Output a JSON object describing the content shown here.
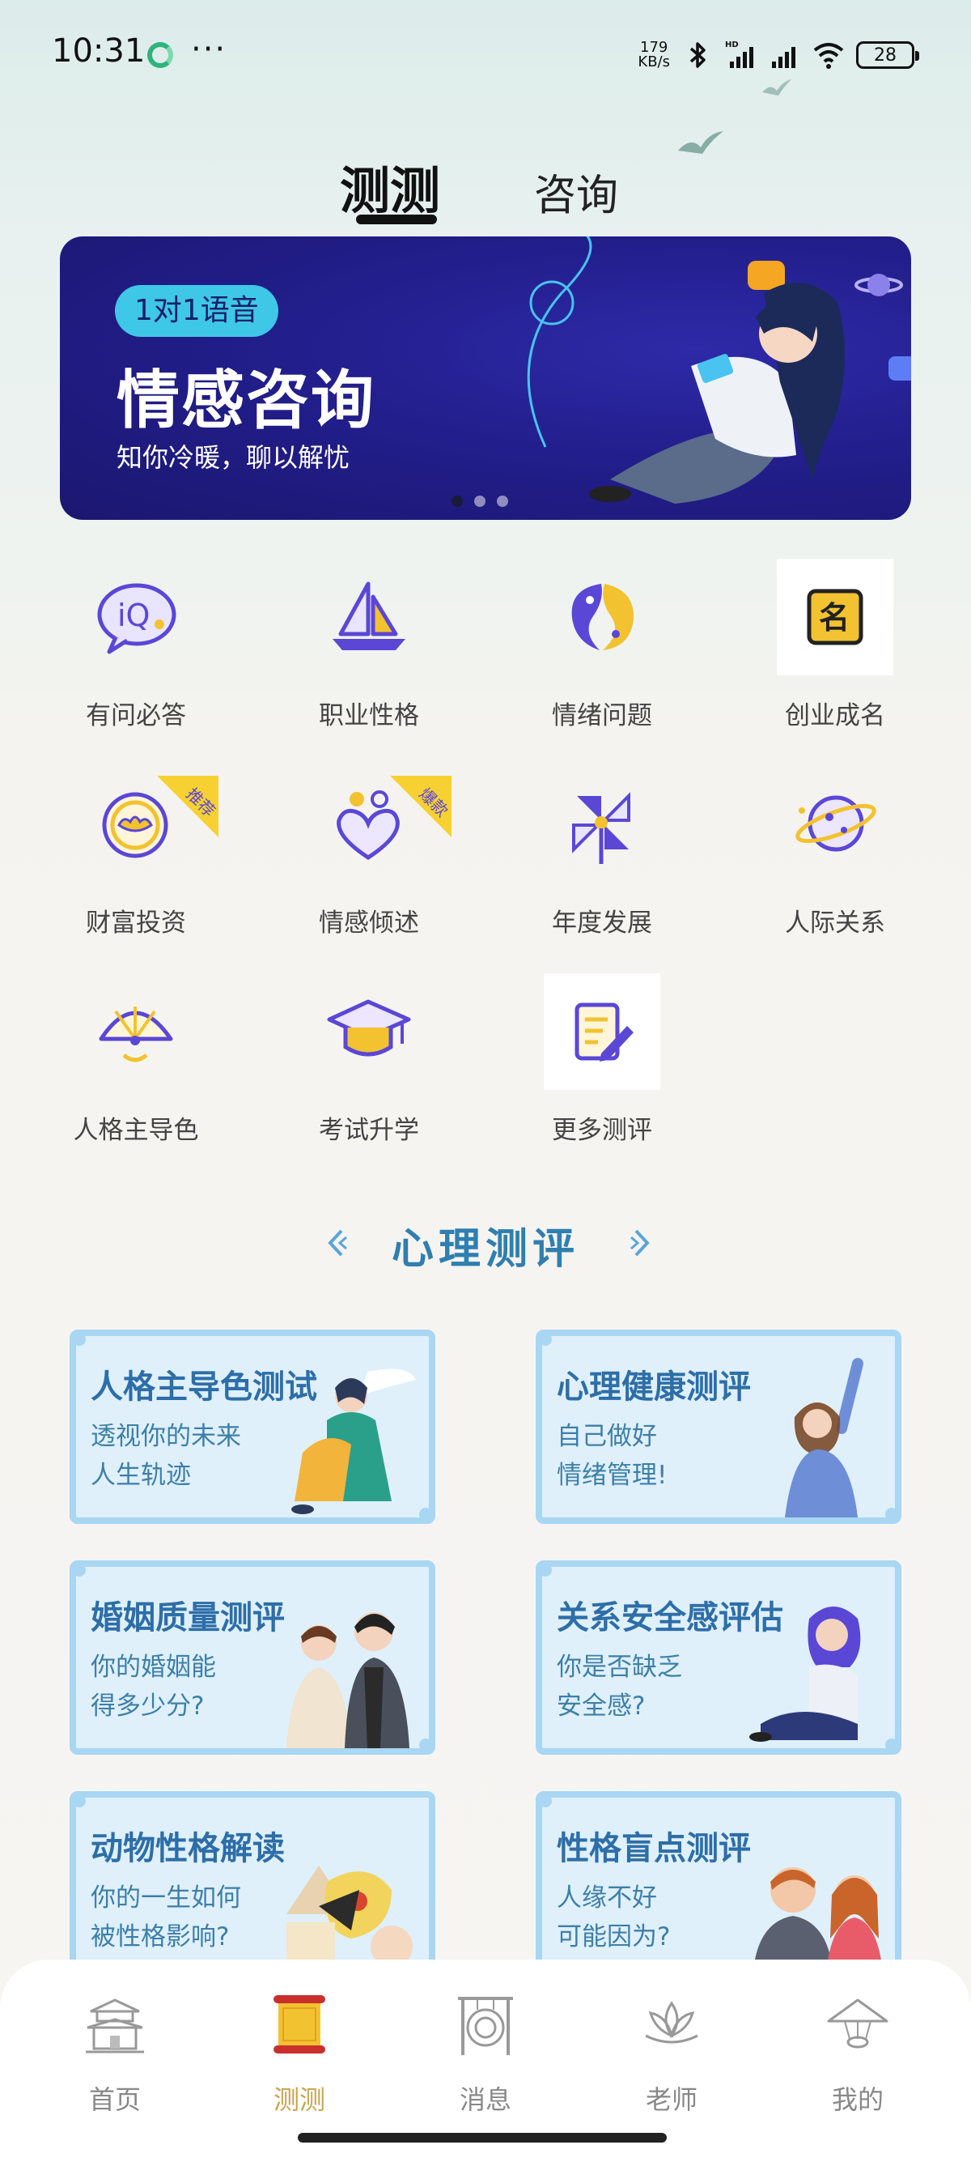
{
  "status_bar": {
    "time": "10:31",
    "dots": "···",
    "net_speed_value": "179",
    "net_speed_unit": "KB/s",
    "battery": "28"
  },
  "top_tabs": {
    "test": "测测",
    "consult": "咨询"
  },
  "banner": {
    "pill": "1对1语音",
    "title": "情感咨询",
    "subtitle": "知你冷暖，聊以解忧",
    "slide_count": 3,
    "active_slide": 1
  },
  "categories": [
    {
      "label": "有问必答",
      "icon": "iq-bubble-icon"
    },
    {
      "label": "职业性格",
      "icon": "sailboat-icon"
    },
    {
      "label": "情绪问题",
      "icon": "yin-yang-fish-icon"
    },
    {
      "label": "创业成名",
      "icon": "name-badge-icon"
    },
    {
      "label": "财富投资",
      "icon": "gold-ingot-icon",
      "badge": "推荐"
    },
    {
      "label": "情感倾述",
      "icon": "heart-person-icon",
      "badge": "爆款"
    },
    {
      "label": "年度发展",
      "icon": "pinwheel-icon"
    },
    {
      "label": "人际关系",
      "icon": "planet-icon"
    },
    {
      "label": "人格主导色",
      "icon": "fan-icon"
    },
    {
      "label": "考试升学",
      "icon": "graduation-cap-icon"
    },
    {
      "label": "更多测评",
      "icon": "pen-notebook-icon"
    }
  ],
  "section": {
    "title": "心理测评"
  },
  "cards": [
    {
      "title": "人格主导色测试",
      "line1": "透视你的未来",
      "line2": "人生轨迹"
    },
    {
      "title": "心理健康测评",
      "line1": "自己做好",
      "line2": "情绪管理!"
    },
    {
      "title": "婚姻质量测评",
      "line1": "你的婚姻能",
      "line2": "得多少分?"
    },
    {
      "title": "关系安全感评估",
      "line1": "你是否缺乏",
      "line2": "安全感?"
    },
    {
      "title": "动物性格解读",
      "line1": "你的一生如何",
      "line2": "被性格影响?"
    },
    {
      "title": "性格盲点测评",
      "line1": "人缘不好",
      "line2": "可能因为?"
    }
  ],
  "bottom_nav": [
    {
      "label": "首页",
      "icon": "palace-icon",
      "active": false
    },
    {
      "label": "测测",
      "icon": "scroll-icon",
      "active": true
    },
    {
      "label": "消息",
      "icon": "gong-icon",
      "active": false
    },
    {
      "label": "老师",
      "icon": "lotus-icon",
      "active": false
    },
    {
      "label": "我的",
      "icon": "lantern-hat-icon",
      "active": false
    }
  ],
  "colors": {
    "accent_gold": "#c9a24c",
    "section_blue": "#2f7fb0",
    "icon_purple": "#5a47d6",
    "icon_yellow": "#f2c230"
  }
}
